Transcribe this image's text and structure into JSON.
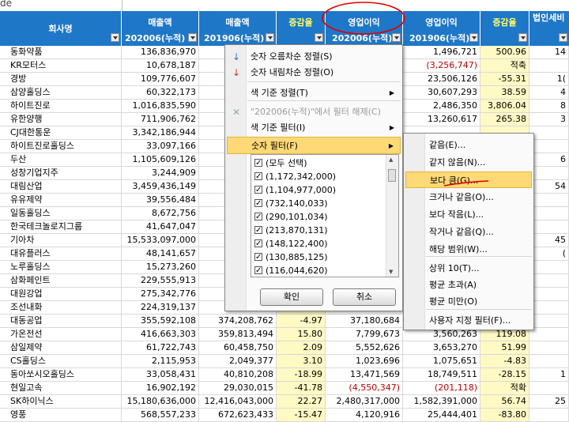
{
  "formula_fragment": "de",
  "headers": {
    "top": [
      "회사명",
      "매출액",
      "매출액",
      "증감율",
      "영업이익",
      "영업이익",
      "증감율",
      "법인세비"
    ],
    "sub": [
      "",
      "202006(누적)",
      "201906(누적)",
      "",
      "202006(누적)",
      "201906(누적)",
      "",
      ""
    ]
  },
  "rows": [
    {
      "name": "동화약품",
      "c1": "136,836,970",
      "c2": "",
      "c3": "",
      "c4": "",
      "c5": "1,496,721",
      "c6": "500.96",
      "c7": "14"
    },
    {
      "name": "KR모터스",
      "c1": "10,678,187",
      "c2": "",
      "c3": "",
      "c4": "",
      "c5": "(3,256,747)",
      "c6": "적축",
      "c7": ""
    },
    {
      "name": "경방",
      "c1": "109,776,607",
      "c2": "",
      "c3": "",
      "c4": "",
      "c5": "23,506,126",
      "c6": "-55.31",
      "c7": "1("
    },
    {
      "name": "삼양홀딩스",
      "c1": "60,322,173",
      "c2": "",
      "c3": "",
      "c4": "",
      "c5": "30,607,293",
      "c6": "38.59",
      "c7": "4"
    },
    {
      "name": "하이트진로",
      "c1": "1,016,835,590",
      "c2": "",
      "c3": "",
      "c4": "",
      "c5": "2,486,350",
      "c6": "3,806.04",
      "c7": "8"
    },
    {
      "name": "유한양행",
      "c1": "711,906,762",
      "c2": "",
      "c3": "",
      "c4": "",
      "c5": "13,260,617",
      "c6": "265.38",
      "c7": "3"
    },
    {
      "name": "CJ대한통운",
      "c1": "3,342,186,944",
      "c2": "3",
      "c3": "",
      "c4": "",
      "c5": "",
      "c6": "",
      "c7": ""
    },
    {
      "name": "하이트진로홀딩스",
      "c1": "33,097,166",
      "c2": "",
      "c3": "",
      "c4": "",
      "c5": "",
      "c6": "",
      "c7": ""
    },
    {
      "name": "두산",
      "c1": "1,105,609,126",
      "c2": "1",
      "c3": "",
      "c4": "",
      "c5": "",
      "c6": "",
      "c7": "6"
    },
    {
      "name": "성창기업지주",
      "c1": "3,244,909",
      "c2": "",
      "c3": "",
      "c4": "",
      "c5": "",
      "c6": "",
      "c7": ""
    },
    {
      "name": "대림산업",
      "c1": "3,459,436,149",
      "c2": "3",
      "c3": "",
      "c4": "",
      "c5": "",
      "c6": "",
      "c7": "54"
    },
    {
      "name": "유유제약",
      "c1": "39,556,484",
      "c2": "",
      "c3": "",
      "c4": "",
      "c5": "",
      "c6": "",
      "c7": ""
    },
    {
      "name": "일동홀딩스",
      "c1": "8,672,756",
      "c2": "",
      "c3": "",
      "c4": "",
      "c5": "",
      "c6": "",
      "c7": ""
    },
    {
      "name": "한국테크놀로지그룹",
      "c1": "41,647,047",
      "c2": "",
      "c3": "",
      "c4": "",
      "c5": "",
      "c6": "",
      "c7": ""
    },
    {
      "name": "기아차",
      "c1": "15,533,097,000",
      "c2": "16",
      "c3": "",
      "c4": "",
      "c5": "",
      "c6": "",
      "c7": "45"
    },
    {
      "name": "대유플러스",
      "c1": "48,141,657",
      "c2": "",
      "c3": "",
      "c4": "",
      "c5": "",
      "c6": "",
      "c7": "("
    },
    {
      "name": "노루홀딩스",
      "c1": "15,273,260",
      "c2": "",
      "c3": "",
      "c4": "",
      "c5": "",
      "c6": "",
      "c7": ""
    },
    {
      "name": "삼화페인트",
      "c1": "229,555,913",
      "c2": "",
      "c3": "",
      "c4": "",
      "c5": "",
      "c6": "",
      "c7": ""
    },
    {
      "name": "대원강업",
      "c1": "275,342,776",
      "c2": "",
      "c3": "",
      "c4": "",
      "c5": "",
      "c6": "",
      "c7": ""
    },
    {
      "name": "조선내화",
      "c1": "224,319,137",
      "c2": "",
      "c3": "",
      "c4": "",
      "c5": "",
      "c6": "",
      "c7": ""
    },
    {
      "name": "대동공업",
      "c1": "355,592,108",
      "c2": "374,208,762",
      "c3": "-4.97",
      "c4": "37,180,684",
      "c5": "",
      "c6": "",
      "c7": ""
    },
    {
      "name": "가온전선",
      "c1": "416,663,303",
      "c2": "359,813,494",
      "c3": "15.80",
      "c4": "7,799,673",
      "c5": "3,560,263",
      "c6": "119.08",
      "c7": ""
    },
    {
      "name": "삼일제약",
      "c1": "61,722,743",
      "c2": "60,458,750",
      "c3": "2.09",
      "c4": "5,552,626",
      "c5": "3,653,270",
      "c6": "51.99",
      "c7": ""
    },
    {
      "name": "CS홀딩스",
      "c1": "2,115,953",
      "c2": "2,049,377",
      "c3": "3.10",
      "c4": "1,023,696",
      "c5": "1,075,651",
      "c6": "-4.83",
      "c7": ""
    },
    {
      "name": "동아쏘시오홀딩스",
      "c1": "33,058,431",
      "c2": "40,810,208",
      "c3": "-18.99",
      "c4": "13,471,569",
      "c5": "18,749,511",
      "c6": "-28.15",
      "c7": "1"
    },
    {
      "name": "현일고속",
      "c1": "16,902,192",
      "c2": "29,030,015",
      "c3": "-41.78",
      "c4": "(4,550,347)",
      "c5": "(201,118)",
      "c6": "적확",
      "c7": ""
    },
    {
      "name": "SK하이닉스",
      "c1": "15,180,636,000",
      "c2": "12,416,043,000",
      "c3": "22.27",
      "c4": "2,480,317,000",
      "c5": "1,582,391,000",
      "c6": "56.74",
      "c7": "25"
    },
    {
      "name": "영풍",
      "c1": "568,557,233",
      "c2": "672,623,433",
      "c3": "-15.47",
      "c4": "4,120,916",
      "c5": "25,444,401",
      "c6": "-83.80",
      "c7": ""
    }
  ],
  "menu": {
    "items": [
      {
        "label": "숫자 오름차순 정렬(S)",
        "icon": "sort-asc-icon",
        "glyph": "↓",
        "arrow": ""
      },
      {
        "label": "숫자 내림차순 정렬(O)",
        "icon": "sort-desc-icon",
        "glyph": "↓",
        "arrow": ""
      },
      {
        "label": "색 기준 정렬(T)",
        "icon": "",
        "glyph": "",
        "arrow": "▶"
      },
      {
        "label": "\"202006(누적)\"에서 필터 해제(C)",
        "icon": "clear-filter-icon",
        "glyph": "✕",
        "arrow": ""
      },
      {
        "label": "색 기준 필터(I)",
        "icon": "",
        "glyph": "",
        "arrow": "▶"
      },
      {
        "label": "숫자 필터(F)",
        "icon": "",
        "glyph": "",
        "arrow": "▶"
      }
    ],
    "filter_values": [
      "(모두 선택)",
      "(1,172,342,000)",
      "(1,104,977,000)",
      "(732,140,033)",
      "(290,101,034)",
      "(213,870,131)",
      "(148,122,400)",
      "(130,885,125)",
      "(116,044,620)"
    ],
    "ok_label": "확인",
    "cancel_label": "취소"
  },
  "submenu": {
    "items": [
      "같음(E)...",
      "같지 않음(N)...",
      "보다 큼(G)...",
      "크거나 같음(O)...",
      "보다 작음(L)...",
      "작거나 같음(Q)...",
      "해당 범위(W)...",
      "상위 10(T)...",
      "평균 초과(A)",
      "평균 미만(O)",
      "사용자 지정 필터(F)..."
    ]
  },
  "colors": {
    "header": "#1f77c8",
    "highlight": "#ffd976",
    "annotation": "#e00000"
  }
}
